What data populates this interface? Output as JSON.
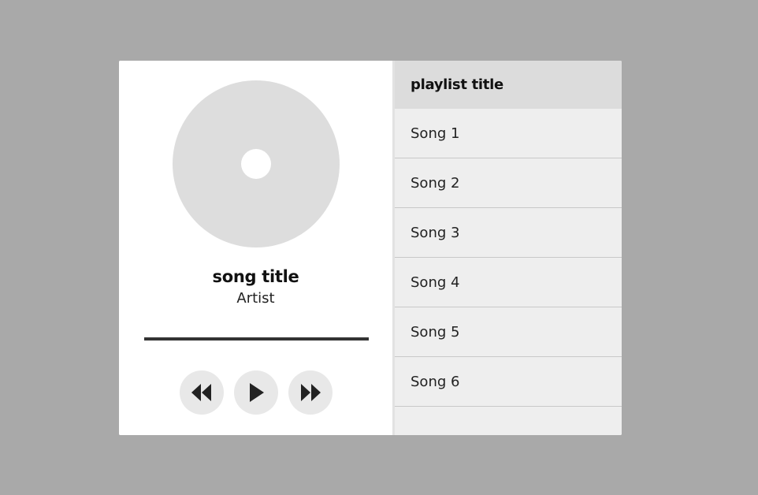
{
  "player": {
    "song_title": "song title",
    "artist": "Artist",
    "progress": 1.0
  },
  "controls": {
    "rewind_icon": "rewind-icon",
    "play_icon": "play-icon",
    "fastforward_icon": "fast-forward-icon"
  },
  "playlist": {
    "title": "playlist title",
    "songs": [
      "Song 1",
      "Song 2",
      "Song 3",
      "Song 4",
      "Song 5",
      "Song 6"
    ]
  },
  "colors": {
    "background": "#a9a9a9",
    "disc": "#dddddd",
    "progress_bar": "#333333",
    "playlist_header": "#dcdcdc",
    "playlist_body": "#eeeeee"
  }
}
